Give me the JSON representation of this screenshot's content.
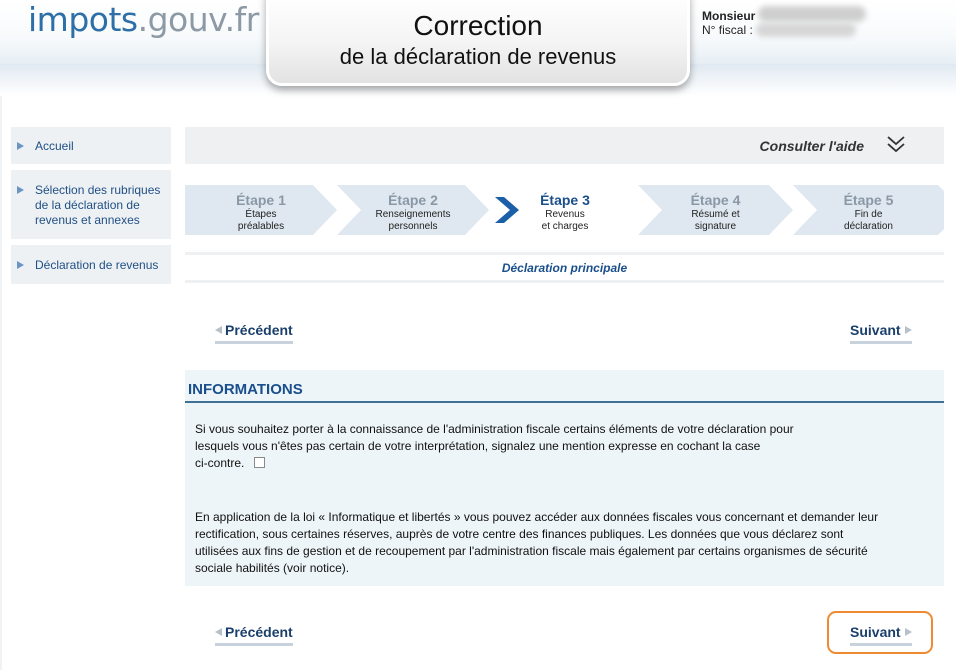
{
  "header": {
    "logo_part1": "impots",
    "logo_part2": ".gouv.fr",
    "title_line1": "Correction",
    "title_line2": "de la déclaration de revenus",
    "user_label": "Monsieur",
    "fiscal_label": "N° fiscal :"
  },
  "sidebar": {
    "items": [
      {
        "label": "Accueil"
      },
      {
        "label_lines": [
          "Sélection des rubriques",
          "de la déclaration de",
          "revenus et annexes"
        ]
      },
      {
        "label": "Déclaration de revenus"
      }
    ]
  },
  "help": {
    "label": "Consulter l'aide",
    "icon": "double-chevron-down-icon"
  },
  "steps": [
    {
      "title": "Étape 1",
      "sub1": "Étapes",
      "sub2": "préalables",
      "current": false
    },
    {
      "title": "Étape 2",
      "sub1": "Renseignements",
      "sub2": "personnels",
      "current": false
    },
    {
      "title": "Étape 3",
      "sub1": "Revenus",
      "sub2": "et charges",
      "current": true
    },
    {
      "title": "Étape 4",
      "sub1": "Résumé et",
      "sub2": "signature",
      "current": false
    },
    {
      "title": "Étape 5",
      "sub1": "Fin de",
      "sub2": "déclaration",
      "current": false
    }
  ],
  "section_label": "Déclaration principale",
  "nav": {
    "prev": "Précédent",
    "next": "Suivant"
  },
  "info": {
    "title": "INFORMATIONS",
    "p1_lines": [
      "Si vous souhaitez porter à la connaissance de l'administration fiscale certains éléments de votre déclaration pour",
      "lesquels vous n'êtes pas certain de votre interprétation, signalez une mention expresse en cochant la case",
      "ci-contre."
    ],
    "p2_lines": [
      "En application de la loi « Informatique et libertés » vous pouvez accéder aux données fiscales vous concernant et demander leur",
      "rectification, sous certaines réserves, auprès de votre centre des finances publiques. Les données que vous déclarez sont",
      "utilisées aux fins de gestion et de recoupement par l'administration fiscale mais également par certains organismes de sécurité",
      "sociale habilités (voir notice)."
    ],
    "checkbox_checked": false
  },
  "colors": {
    "brand_blue": "#2d6fa6",
    "accent_orange": "#f08a30",
    "link_blue": "#1a4f8c"
  }
}
